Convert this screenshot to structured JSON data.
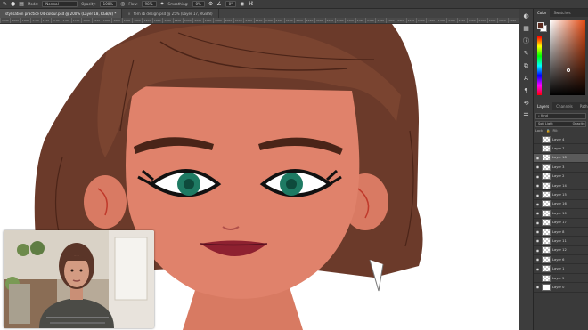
{
  "options_bar": {
    "mode_label": "Mode:",
    "mode_value": "Normal",
    "opacity_label": "Opacity:",
    "opacity_value": "100%",
    "flow_label": "Flow:",
    "flow_value": "98%",
    "smoothing_label": "Smoothing:",
    "smoothing_value": "0%",
    "angle_value": "0°"
  },
  "tabs": [
    {
      "label": "stylisation practice 04-colour.psd @ 200% (Layer 18, RGB/8) *",
      "active": true
    },
    {
      "label": "fern rb design.psd @ 25% (Layer 17, RGB/8)",
      "active": false
    }
  ],
  "ruler": [
    "1640",
    "1660",
    "1680",
    "1700",
    "1720",
    "1740",
    "1760",
    "1780",
    "1800",
    "1820",
    "1840",
    "1860",
    "1880",
    "1900",
    "1920",
    "1940",
    "1960",
    "1980",
    "2000",
    "2020",
    "2040",
    "2060",
    "2080",
    "2100",
    "2120",
    "2140",
    "2160",
    "2180",
    "2200",
    "2220",
    "2240",
    "2260",
    "2280",
    "2300",
    "2320",
    "2340",
    "2360",
    "2380",
    "2400",
    "2420",
    "2440",
    "2460",
    "2480",
    "2500",
    "2520",
    "2540",
    "2560",
    "2580",
    "2600",
    "2620",
    "2640"
  ],
  "color_panel": {
    "tabs": [
      "Color",
      "Swatches"
    ],
    "foreground": "#5a2a1e",
    "background": "#ffffff",
    "hue_color": "#e24a12"
  },
  "layers_panel": {
    "tabs": [
      "Layers",
      "Channels",
      "Paths"
    ],
    "search_placeholder": "Kind",
    "blend_mode": "Soft Light",
    "opacity_label": "Opacity:",
    "lock_label": "Lock:",
    "fill_label": "Fill:",
    "layers": [
      {
        "name": "Layer 4",
        "visible": false,
        "selected": false
      },
      {
        "name": "Layer 7",
        "visible": false,
        "selected": false
      },
      {
        "name": "Layer 18",
        "visible": true,
        "selected": true
      },
      {
        "name": "Layer 3",
        "visible": true,
        "selected": false
      },
      {
        "name": "Layer 2",
        "visible": true,
        "selected": false
      },
      {
        "name": "Layer 14",
        "visible": true,
        "selected": false
      },
      {
        "name": "Layer 15",
        "visible": true,
        "selected": false
      },
      {
        "name": "Layer 16",
        "visible": true,
        "selected": false
      },
      {
        "name": "Layer 10",
        "visible": true,
        "selected": false
      },
      {
        "name": "Layer 17",
        "visible": true,
        "selected": false
      },
      {
        "name": "Layer 8",
        "visible": true,
        "selected": false
      },
      {
        "name": "Layer 11",
        "visible": true,
        "selected": false
      },
      {
        "name": "Layer 12",
        "visible": true,
        "selected": false
      },
      {
        "name": "Layer 6",
        "visible": true,
        "selected": false
      },
      {
        "name": "Layer 1",
        "visible": true,
        "selected": false
      },
      {
        "name": "Layer 5",
        "visible": false,
        "selected": false
      },
      {
        "name": "Layer 0",
        "visible": true,
        "selected": false
      }
    ]
  }
}
